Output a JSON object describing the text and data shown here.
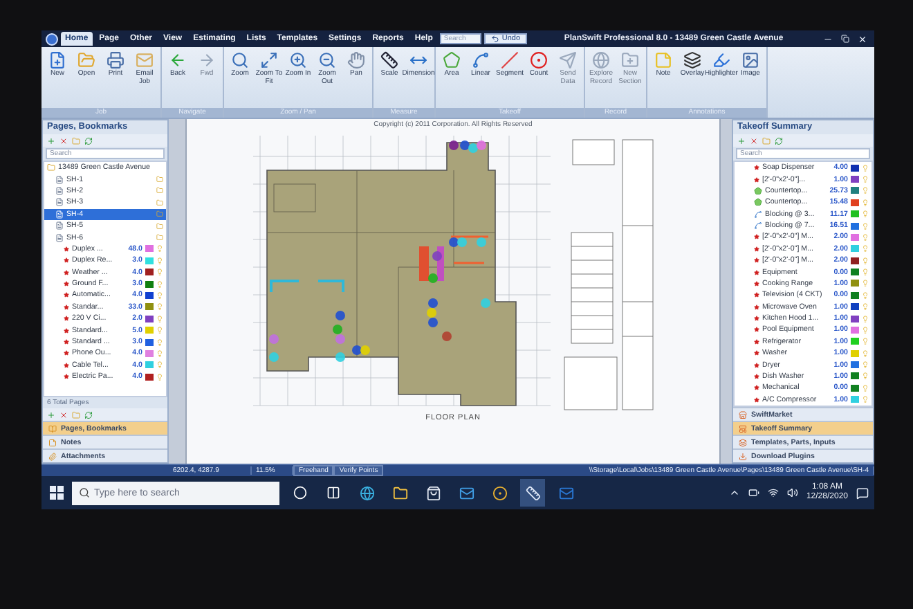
{
  "title_bar": {
    "menu": [
      {
        "label": "Home",
        "selected": true
      },
      {
        "label": "Page",
        "selected": false
      },
      {
        "label": "Other",
        "selected": false
      },
      {
        "label": "View",
        "selected": false
      },
      {
        "label": "Estimating",
        "selected": false
      },
      {
        "label": "Lists",
        "selected": false
      },
      {
        "label": "Templates",
        "selected": false
      },
      {
        "label": "Settings",
        "selected": false
      },
      {
        "label": "Reports",
        "selected": false
      },
      {
        "label": "Help",
        "selected": false
      }
    ],
    "search": {
      "placeholder": "Search"
    },
    "undo": "Undo",
    "title": "PlanSwift Professional 8.0 - 13489 Green Castle Avenue"
  },
  "ribbon": [
    {
      "label": "Job",
      "buttons": [
        {
          "label": "New",
          "disabled": false
        },
        {
          "label": "Open",
          "disabled": false
        },
        {
          "label": "Print",
          "disabled": false
        },
        {
          "label": "Email Job",
          "disabled": false
        }
      ]
    },
    {
      "label": "Navigate",
      "buttons": [
        {
          "label": "Back",
          "disabled": false
        },
        {
          "label": "Fwd",
          "disabled": true
        }
      ]
    },
    {
      "label": "Zoom / Pan",
      "buttons": [
        {
          "label": "Zoom",
          "disabled": false
        },
        {
          "label": "Zoom To Fit",
          "disabled": false
        },
        {
          "label": "Zoom In",
          "disabled": false
        },
        {
          "label": "Zoom Out",
          "disabled": false
        },
        {
          "label": "Pan",
          "disabled": false
        }
      ]
    },
    {
      "label": "Measure",
      "buttons": [
        {
          "label": "Scale",
          "disabled": false
        },
        {
          "label": "Dimension",
          "disabled": false
        }
      ]
    },
    {
      "label": "Takeoff",
      "buttons": [
        {
          "label": "Area",
          "disabled": false
        },
        {
          "label": "Linear",
          "disabled": false
        },
        {
          "label": "Segment",
          "disabled": false
        },
        {
          "label": "Count",
          "disabled": false
        },
        {
          "label": "Send Data",
          "disabled": true
        }
      ]
    },
    {
      "label": "Record",
      "buttons": [
        {
          "label": "Explore Record",
          "disabled": true
        },
        {
          "label": "New Section",
          "disabled": true
        }
      ]
    },
    {
      "label": "Annotations",
      "buttons": [
        {
          "label": "Note",
          "disabled": false
        },
        {
          "label": "Overlay",
          "disabled": false
        },
        {
          "label": "Highlighter",
          "disabled": false
        },
        {
          "label": "Image",
          "disabled": false
        }
      ]
    }
  ],
  "left_panel": {
    "title": "Pages, Bookmarks",
    "search": {
      "placeholder": "Search"
    },
    "tree": [
      {
        "label": "13489 Green Castle Avenue",
        "kind": "job",
        "selected": false,
        "children": [
          {
            "label": "SH-1",
            "kind": "sheet",
            "selected": false
          },
          {
            "label": "SH-2",
            "kind": "sheet",
            "selected": false
          },
          {
            "label": "SH-3",
            "kind": "sheet",
            "selected": false
          },
          {
            "label": "SH-4",
            "kind": "sheet",
            "selected": true
          },
          {
            "label": "SH-5",
            "kind": "sheet",
            "selected": false
          },
          {
            "label": "SH-6",
            "kind": "sheet",
            "selected": false,
            "children": [
              {
                "label": "Duplex ...",
                "kind": "item",
                "value": "48.0",
                "color": "#e070e0",
                "selected": false
              },
              {
                "label": "Duplex Re...",
                "kind": "item",
                "value": "3.0",
                "color": "#30e0e0",
                "selected": false
              },
              {
                "label": "Weather ...",
                "kind": "item",
                "value": "4.0",
                "color": "#a02020",
                "selected": false
              },
              {
                "label": "Ground F...",
                "kind": "item",
                "value": "3.0",
                "color": "#108010",
                "selected": false
              },
              {
                "label": "Automatic...",
                "kind": "item",
                "value": "4.0",
                "color": "#1040d0",
                "selected": false
              },
              {
                "label": "Standar...",
                "kind": "item",
                "value": "33.0",
                "color": "#909010",
                "selected": false
              },
              {
                "label": "220 V Ci...",
                "kind": "item",
                "value": "2.0",
                "color": "#8040c0",
                "selected": false
              },
              {
                "label": "Standard...",
                "kind": "item",
                "value": "5.0",
                "color": "#e0d000",
                "selected": false
              },
              {
                "label": "Standard ...",
                "kind": "item",
                "value": "3.0",
                "color": "#2060e0",
                "selected": false
              },
              {
                "label": "Phone Ou...",
                "kind": "item",
                "value": "4.0",
                "color": "#e080e0",
                "selected": false
              },
              {
                "label": "Cable Tel...",
                "kind": "item",
                "value": "4.0",
                "color": "#30d0e0",
                "selected": false
              },
              {
                "label": "Electric Pa...",
                "kind": "item",
                "value": "4.0",
                "color": "#b02020",
                "selected": false
              }
            ]
          }
        ]
      }
    ],
    "footer": "6 Total Pages",
    "nav": [
      {
        "label": "Pages, Bookmarks",
        "selected": true
      },
      {
        "label": "Notes",
        "selected": false
      },
      {
        "label": "Attachments",
        "selected": false
      }
    ]
  },
  "canvas": {
    "copyright": "Copyright (c) 2011 Corporation. All Rights Reserved",
    "caption": "FLOOR PLAN"
  },
  "right_panel": {
    "title": "Takeoff Summary",
    "search": {
      "placeholder": "Search"
    },
    "items": [
      {
        "label": "Soap Dispenser",
        "kind": "count",
        "value": "4.00",
        "color": "#1030b0"
      },
      {
        "label": "[2'-0\"x2'-0\"]...",
        "kind": "count",
        "value": "1.00",
        "color": "#8040c0"
      },
      {
        "label": "Countertop...",
        "kind": "area",
        "value": "25.73",
        "color": "#208080"
      },
      {
        "label": "Countertop...",
        "kind": "area",
        "value": "15.48",
        "color": "#e04020"
      },
      {
        "label": "Blocking @ 3...",
        "kind": "linear",
        "value": "11.17",
        "color": "#20c020"
      },
      {
        "label": "Blocking @ 7...",
        "kind": "linear",
        "value": "16.51",
        "color": "#2070e0"
      },
      {
        "label": "[2'-0\"x2'-0\"] M...",
        "kind": "count",
        "value": "2.00",
        "color": "#e070e0"
      },
      {
        "label": "[2'-0\"x2'-0\"] M...",
        "kind": "count",
        "value": "2.00",
        "color": "#30d0e0"
      },
      {
        "label": "[2'-0\"x2'-0\"] M...",
        "kind": "count",
        "value": "2.00",
        "color": "#902020"
      },
      {
        "label": "Equipment",
        "kind": "count",
        "value": "0.00",
        "color": "#108020"
      },
      {
        "label": "Cooking Range",
        "kind": "count",
        "value": "1.00",
        "color": "#909010"
      },
      {
        "label": "Television (4 CKT)",
        "kind": "count",
        "value": "0.00",
        "color": "#108020"
      },
      {
        "label": "Microwave Oven",
        "kind": "count",
        "value": "1.00",
        "color": "#1040c0"
      },
      {
        "label": "Kitchen Hood 1...",
        "kind": "count",
        "value": "1.00",
        "color": "#8040c0"
      },
      {
        "label": "Pool Equipment",
        "kind": "count",
        "value": "1.00",
        "color": "#e070e0"
      },
      {
        "label": "Refrigerator",
        "kind": "count",
        "value": "1.00",
        "color": "#20d020"
      },
      {
        "label": "Washer",
        "kind": "count",
        "value": "1.00",
        "color": "#e0d000"
      },
      {
        "label": "Dryer",
        "kind": "count",
        "value": "1.00",
        "color": "#2070e0"
      },
      {
        "label": "Dish Washer",
        "kind": "count",
        "value": "1.00",
        "color": "#108020"
      },
      {
        "label": "Mechanical",
        "kind": "count",
        "value": "0.00",
        "color": "#108020"
      },
      {
        "label": "A/C Compressor",
        "kind": "count",
        "value": "1.00",
        "color": "#30d0e0"
      }
    ],
    "nav": [
      {
        "label": "SwiftMarket",
        "selected": false
      },
      {
        "label": "Takeoff Summary",
        "selected": true
      },
      {
        "label": "Templates, Parts, Inputs",
        "selected": false
      },
      {
        "label": "Download Plugins",
        "selected": false
      }
    ]
  },
  "status_bar": {
    "coordinates": "6202.4, 4287.9",
    "zoom": "11.5%",
    "modes": [
      "Freehand",
      "Verify Points"
    ],
    "path": "\\\\Storage\\Local\\Jobs\\13489 Green Castle Avenue\\Pages\\13489 Green Castle Avenue\\SH-4"
  },
  "taskbar": {
    "search": {
      "placeholder": "Type here to search"
    },
    "time": "1:08 AM",
    "date": "12/28/2020"
  }
}
